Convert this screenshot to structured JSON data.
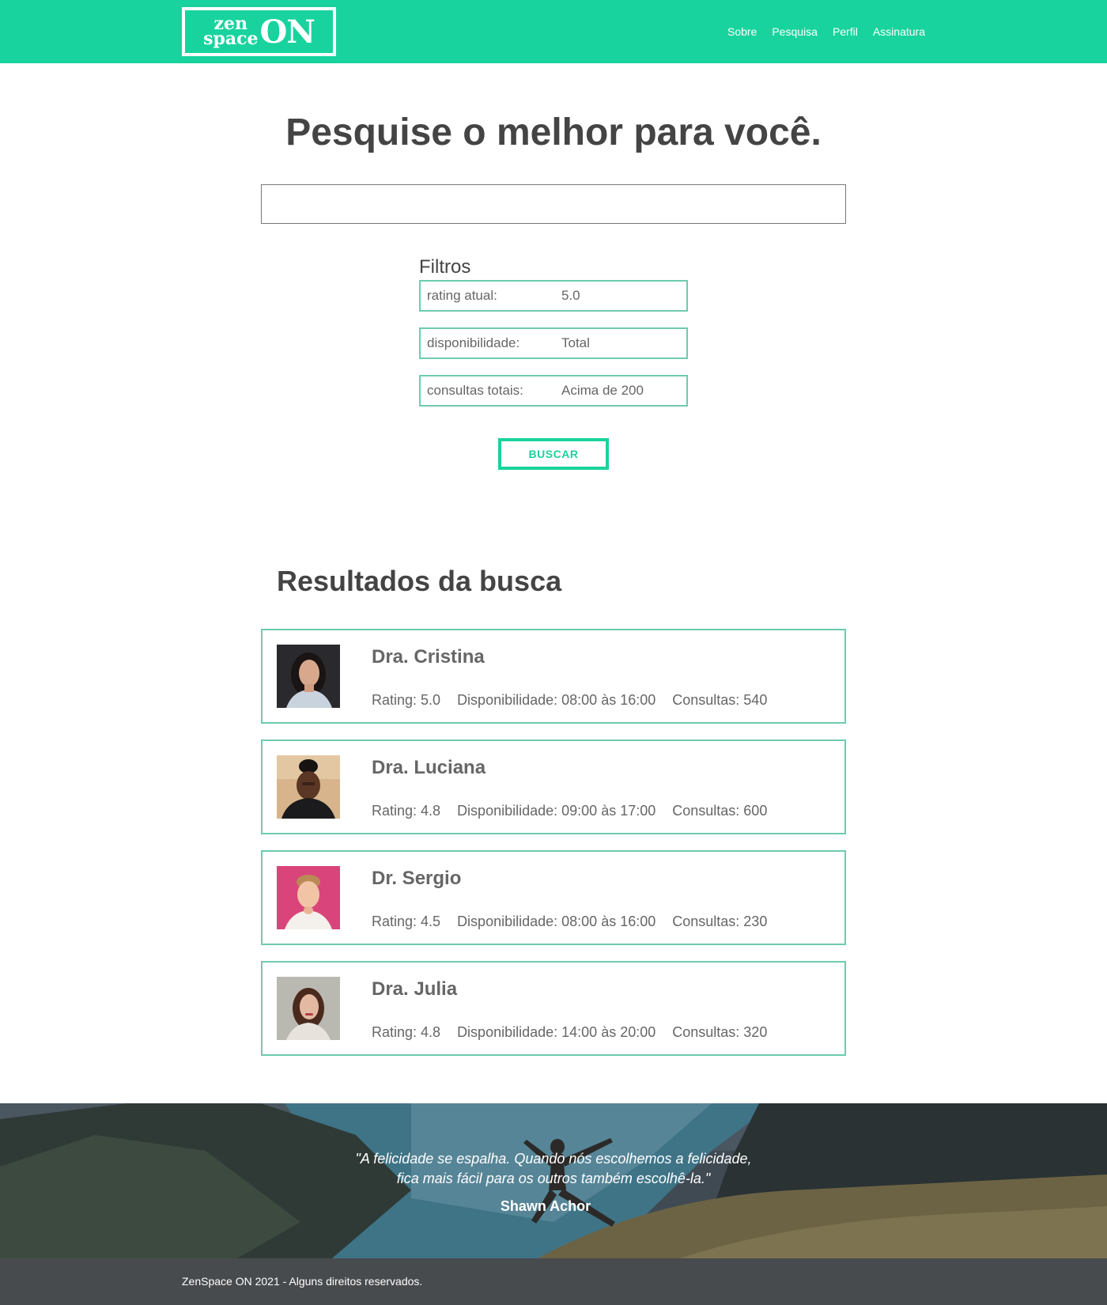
{
  "header": {
    "logo": {
      "line1": "zen",
      "line2": "space",
      "big": "ON"
    },
    "nav": [
      "Sobre",
      "Pesquisa",
      "Perfil",
      "Assinatura"
    ]
  },
  "search": {
    "title": "Pesquise o melhor para você.",
    "input_value": "",
    "input_placeholder": "",
    "filters_label": "Filtros",
    "filters": [
      {
        "label": "rating atual:",
        "value": "5.0"
      },
      {
        "label": "disponibilidade:",
        "value": "Total"
      },
      {
        "label": "consultas totais:",
        "value": "Acima de 200"
      }
    ],
    "button": "BUSCAR"
  },
  "results": {
    "title": "Resultados da busca",
    "items": [
      {
        "name": "Dra. Cristina",
        "rating": "Rating: 5.0",
        "availability": "Disponibilidade: 08:00 às 16:00",
        "consultations": "Consultas: 540"
      },
      {
        "name": "Dra. Luciana",
        "rating": "Rating: 4.8",
        "availability": "Disponibilidade: 09:00 às 17:00",
        "consultations": "Consultas: 600"
      },
      {
        "name": "Dr. Sergio",
        "rating": "Rating: 4.5",
        "availability": "Disponibilidade: 08:00 às 16:00",
        "consultations": "Consultas: 230"
      },
      {
        "name": "Dra. Julia",
        "rating": "Rating: 4.8",
        "availability": "Disponibilidade: 14:00 às 20:00",
        "consultations": "Consultas: 320"
      }
    ]
  },
  "quote": {
    "line1": "\"A felicidade se espalha. Quando nós escolhemos a felicidade,",
    "line2": "fica mais fácil para os outros também escolhê-la.\"",
    "author": "Shawn Achor"
  },
  "footer": {
    "text": "ZenSpace ON 2021 - Alguns direitos reservados."
  },
  "colors": {
    "brand": "#19d39e",
    "border": "#6dcbae",
    "text": "#444444",
    "footer": "#484b4e"
  }
}
